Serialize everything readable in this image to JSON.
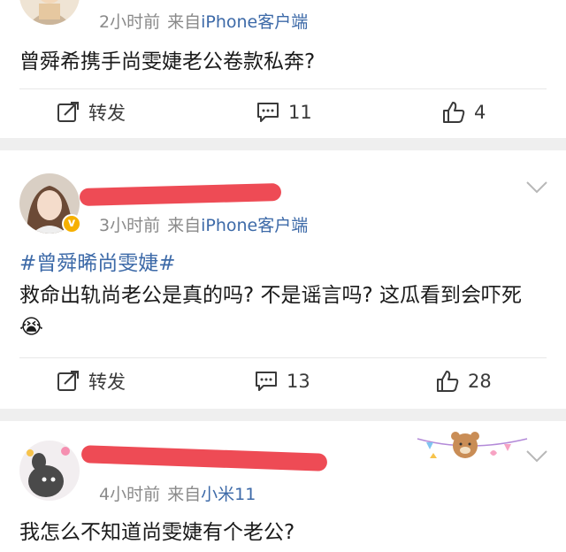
{
  "post1": {
    "time": "2小时前",
    "source_prefix": "来自",
    "device": "iPhone客户端",
    "text": "曾舜希携手尚雯婕老公卷款私奔?",
    "actions": {
      "repost": "转发",
      "comments": "11",
      "likes": "4"
    }
  },
  "post2": {
    "time": "3小时前",
    "source_prefix": "来自",
    "device": "iPhone客户端",
    "hashtag": "#曾舜晞尚雯婕#",
    "text": "救命出轨尚老公是真的吗? 不是谣言吗? 这瓜看到会吓死",
    "emoji": "😭",
    "verified_badge": "v",
    "actions": {
      "repost": "转发",
      "comments": "13",
      "likes": "28"
    }
  },
  "post3": {
    "time": "4小时前",
    "source_prefix": "来自",
    "device": "小米11",
    "text": "我怎么不知道尚雯婕有个老公?"
  },
  "colors": {
    "link_blue": "#3d6aa8",
    "meta_gray": "#8a8a8a",
    "redaction_red": "#ee4b55",
    "separator": "#efefef"
  },
  "icons": [
    "repost-icon",
    "comment-icon",
    "like-icon",
    "chevron-down-icon",
    "verified-badge-icon"
  ]
}
